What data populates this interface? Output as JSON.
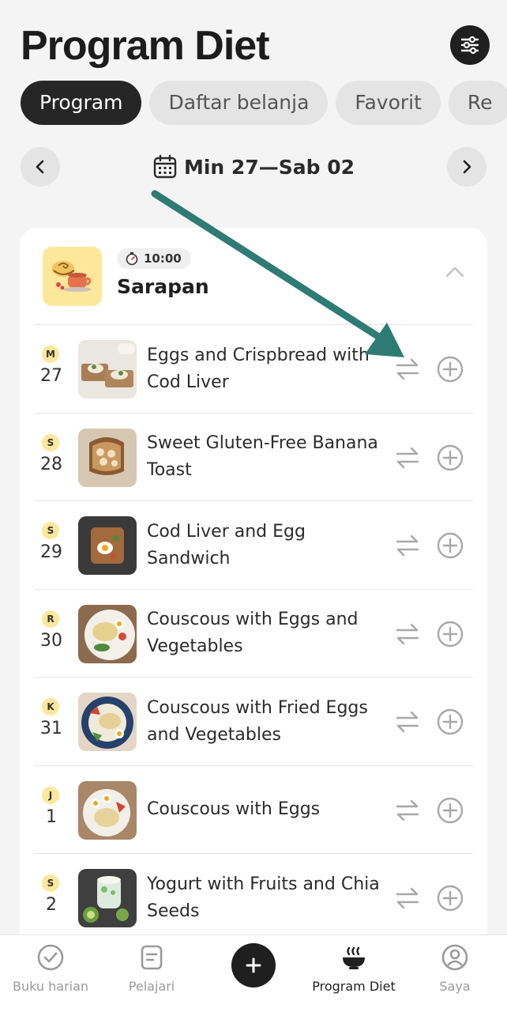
{
  "header": {
    "title": "Program Diet",
    "filter_icon": "sliders-icon"
  },
  "tabs": [
    {
      "label": "Program",
      "active": true
    },
    {
      "label": "Daftar belanja",
      "active": false
    },
    {
      "label": "Favorit",
      "active": false
    },
    {
      "label": "Re",
      "active": false
    }
  ],
  "week": {
    "label": "Min 27—Sab 02",
    "prev_icon": "chevron-left-icon",
    "next_icon": "chevron-right-icon",
    "calendar_icon": "calendar-icon"
  },
  "meal": {
    "time": "10:00",
    "name": "Sarapan",
    "icon": "breakfast-icon",
    "items": [
      {
        "day_letter": "M",
        "day_num": "27",
        "title": "Eggs and Crispbread with Cod Liver"
      },
      {
        "day_letter": "S",
        "day_num": "28",
        "title": "Sweet Gluten-Free Banana Toast"
      },
      {
        "day_letter": "S",
        "day_num": "29",
        "title": "Cod Liver and Egg Sandwich"
      },
      {
        "day_letter": "R",
        "day_num": "30",
        "title": "Couscous with Eggs and Vegetables"
      },
      {
        "day_letter": "K",
        "day_num": "31",
        "title": "Couscous with Fried Eggs and Vegetables"
      },
      {
        "day_letter": "J",
        "day_num": "1",
        "title": "Couscous with Eggs"
      },
      {
        "day_letter": "S",
        "day_num": "2",
        "title": "Yogurt with Fruits and Chia Seeds"
      }
    ]
  },
  "bottom_nav": [
    {
      "label": "Buku harian",
      "icon": "check-circle-icon",
      "active": false
    },
    {
      "label": "Pelajari",
      "icon": "book-icon",
      "active": false
    },
    {
      "label": "",
      "icon": "plus-icon",
      "active": false
    },
    {
      "label": "Program Diet",
      "icon": "bowl-icon",
      "active": true
    },
    {
      "label": "Saya",
      "icon": "profile-icon",
      "active": false
    }
  ],
  "colors": {
    "accent_dark": "#1f1f1f",
    "day_badge": "#fde79a",
    "annotation_arrow": "#2e7b73"
  }
}
